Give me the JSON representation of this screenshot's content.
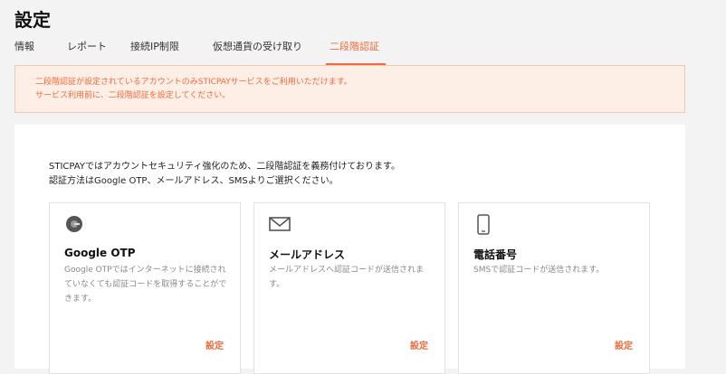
{
  "page": {
    "title": "設定"
  },
  "tabs": [
    {
      "label": "情報"
    },
    {
      "label": "レポート"
    },
    {
      "label": "接続IP制限"
    },
    {
      "label": "仮想通貨の受け取り"
    },
    {
      "label": "二段階認証"
    }
  ],
  "active_tab": "二段階認証",
  "notice": {
    "line1": "二段階認証が設定されているアカウントのみSTICPAYサービスをご利用いただけます。",
    "line2": "サービス利用前に、二段階認証を設定してください。"
  },
  "intro": {
    "line1": "STICPAYではアカウントセキュリティ強化のため、二段階認証を義務付けております。",
    "line2": "認証方法はGoogle OTP、メールアドレス、SMSよりご選択ください。"
  },
  "methods": [
    {
      "icon": "google-otp-icon",
      "title": "Google OTP",
      "description": "Google OTPではインターネットに接続されていなくても認証コードを取得することができます。",
      "button": "設定"
    },
    {
      "icon": "envelope-icon",
      "title": "メールアドレス",
      "description": "メールアドレスへ認証コードが送信されます。",
      "button": "設定"
    },
    {
      "icon": "smartphone-icon",
      "title": "電話番号",
      "description": "SMSで認証コードが送信されます。",
      "button": "設定"
    }
  ],
  "colors": {
    "accent": "#f06a3c",
    "notice_bg": "#fdeee6",
    "page_bg": "#f3f3f3"
  }
}
